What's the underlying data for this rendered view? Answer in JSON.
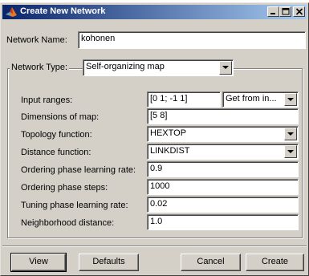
{
  "window": {
    "title": "Create New Network",
    "controls": [
      "minimize",
      "maximize",
      "close"
    ]
  },
  "network_name": {
    "label": "Network Name:",
    "value": "kohonen"
  },
  "network_type": {
    "label": "Network Type:",
    "value": "Self-organizing map"
  },
  "params": {
    "input_ranges": {
      "label": "Input ranges:",
      "value": "[0 1; -1 1]",
      "action": "Get from in..."
    },
    "dimensions": {
      "label": "Dimensions of map:",
      "value": "[5 8]"
    },
    "topology": {
      "label": "Topology function:",
      "value": "HEXTOP"
    },
    "distance": {
      "label": "Distance function:",
      "value": "LINKDIST"
    },
    "order_lr": {
      "label": "Ordering phase learning rate:",
      "value": "0.9"
    },
    "order_steps": {
      "label": "Ordering phase steps:",
      "value": "1000"
    },
    "tune_lr": {
      "label": "Tuning phase learning rate:",
      "value": "0.02"
    },
    "neighborhood": {
      "label": "Neighborhood distance:",
      "value": "1.0"
    }
  },
  "buttons": {
    "view": "View",
    "defaults": "Defaults",
    "cancel": "Cancel",
    "create": "Create"
  },
  "colors": {
    "titlebar_start": "#0a246a",
    "titlebar_end": "#a6caf0",
    "face": "#d4d0c8",
    "field": "#ffffff"
  }
}
